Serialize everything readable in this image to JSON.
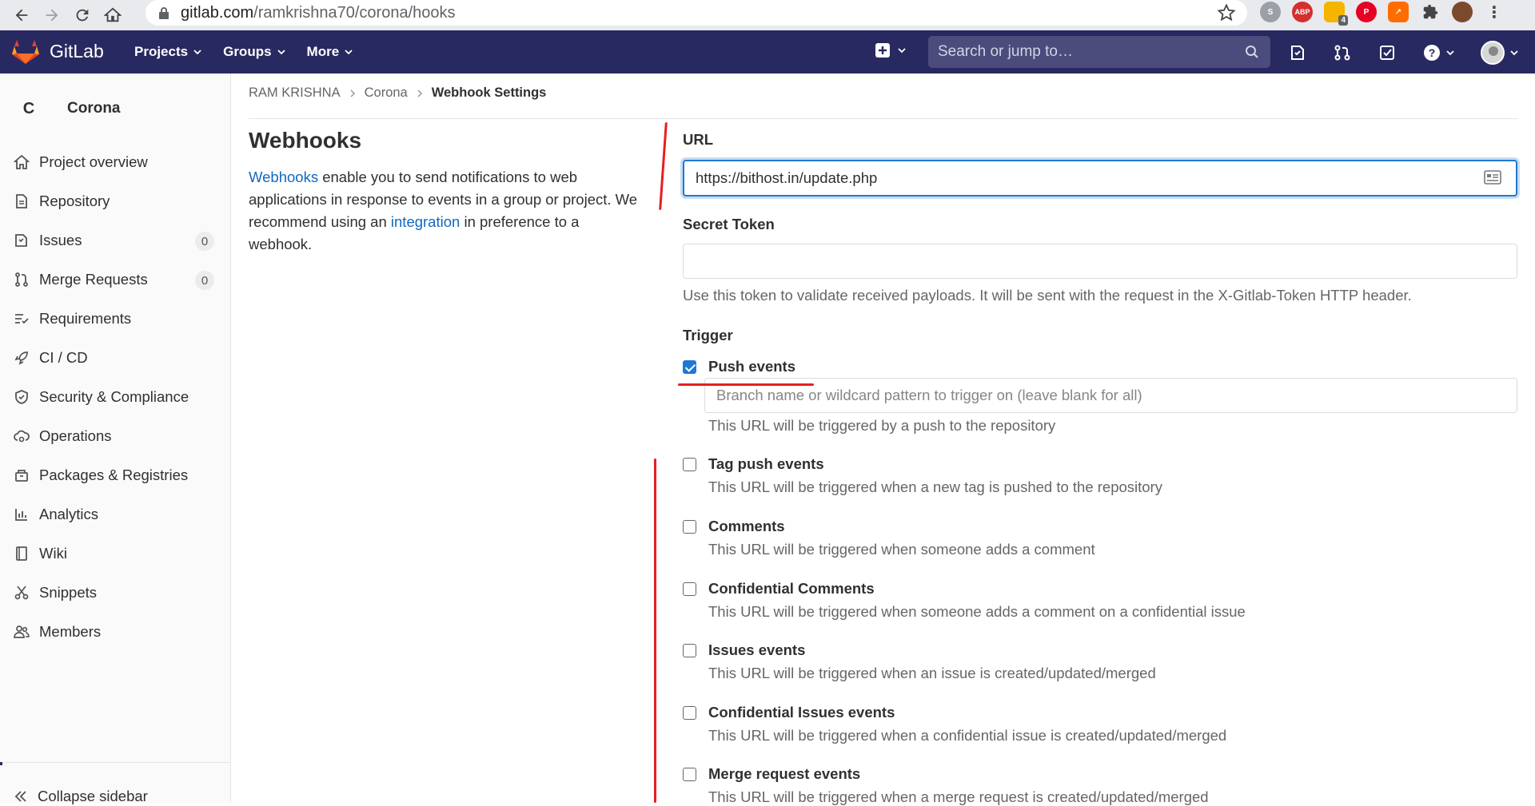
{
  "browser": {
    "url_host": "gitlab.com",
    "url_path": "/ramkrishna70/corona/hooks",
    "extension_badge": "4",
    "abp_label": "ABP"
  },
  "topnav": {
    "brand": "GitLab",
    "menus": [
      "Projects",
      "Groups",
      "More"
    ],
    "search_placeholder": "Search or jump to…"
  },
  "sidebar": {
    "project_letter": "C",
    "project_name": "Corona",
    "items": [
      {
        "label": "Project overview",
        "icon": "home-icon"
      },
      {
        "label": "Repository",
        "icon": "doc-icon"
      },
      {
        "label": "Issues",
        "icon": "issues-icon",
        "count": "0"
      },
      {
        "label": "Merge Requests",
        "icon": "merge-request-icon",
        "count": "0"
      },
      {
        "label": "Requirements",
        "icon": "requirements-icon"
      },
      {
        "label": "CI / CD",
        "icon": "rocket-icon"
      },
      {
        "label": "Security & Compliance",
        "icon": "shield-icon"
      },
      {
        "label": "Operations",
        "icon": "cloud-gear-icon"
      },
      {
        "label": "Packages & Registries",
        "icon": "package-icon"
      },
      {
        "label": "Analytics",
        "icon": "chart-icon"
      },
      {
        "label": "Wiki",
        "icon": "book-icon"
      },
      {
        "label": "Snippets",
        "icon": "scissors-icon"
      },
      {
        "label": "Members",
        "icon": "users-icon"
      }
    ],
    "collapse_label": "Collapse sidebar"
  },
  "breadcrumb": {
    "items": [
      "RAM KRISHNA",
      "Corona"
    ],
    "current": "Webhook Settings"
  },
  "settings": {
    "title": "Webhooks",
    "desc_link1": "Webhooks",
    "desc_part1": " enable you to send notifications to web applications in response to events in a group or project. We recommend using an ",
    "desc_link2": "integration",
    "desc_part2": " in preference to a webhook."
  },
  "form": {
    "url_label": "URL",
    "url_value": "https://bithost.in/update.php",
    "secret_label": "Secret Token",
    "secret_value": "",
    "secret_help": "Use this token to validate received payloads. It will be sent with the request in the X-Gitlab-Token HTTP header.",
    "trigger_label": "Trigger",
    "branch_placeholder": "Branch name or wildcard pattern to trigger on (leave blank for all)",
    "triggers": [
      {
        "label": "Push events",
        "checked": true,
        "help": "This URL will be triggered by a push to the repository"
      },
      {
        "label": "Tag push events",
        "checked": false,
        "help": "This URL will be triggered when a new tag is pushed to the repository"
      },
      {
        "label": "Comments",
        "checked": false,
        "help": "This URL will be triggered when someone adds a comment"
      },
      {
        "label": "Confidential Comments",
        "checked": false,
        "help": "This URL will be triggered when someone adds a comment on a confidential issue"
      },
      {
        "label": "Issues events",
        "checked": false,
        "help": "This URL will be triggered when an issue is created/updated/merged"
      },
      {
        "label": "Confidential Issues events",
        "checked": false,
        "help": "This URL will be triggered when a confidential issue is created/updated/merged"
      },
      {
        "label": "Merge request events",
        "checked": false,
        "help": "This URL will be triggered when a merge request is created/updated/merged"
      }
    ]
  },
  "colors": {
    "nav_bg": "#292961",
    "link": "#1068bf",
    "checkbox_checked": "#1f78d1",
    "annotation_red": "#e5201e"
  }
}
